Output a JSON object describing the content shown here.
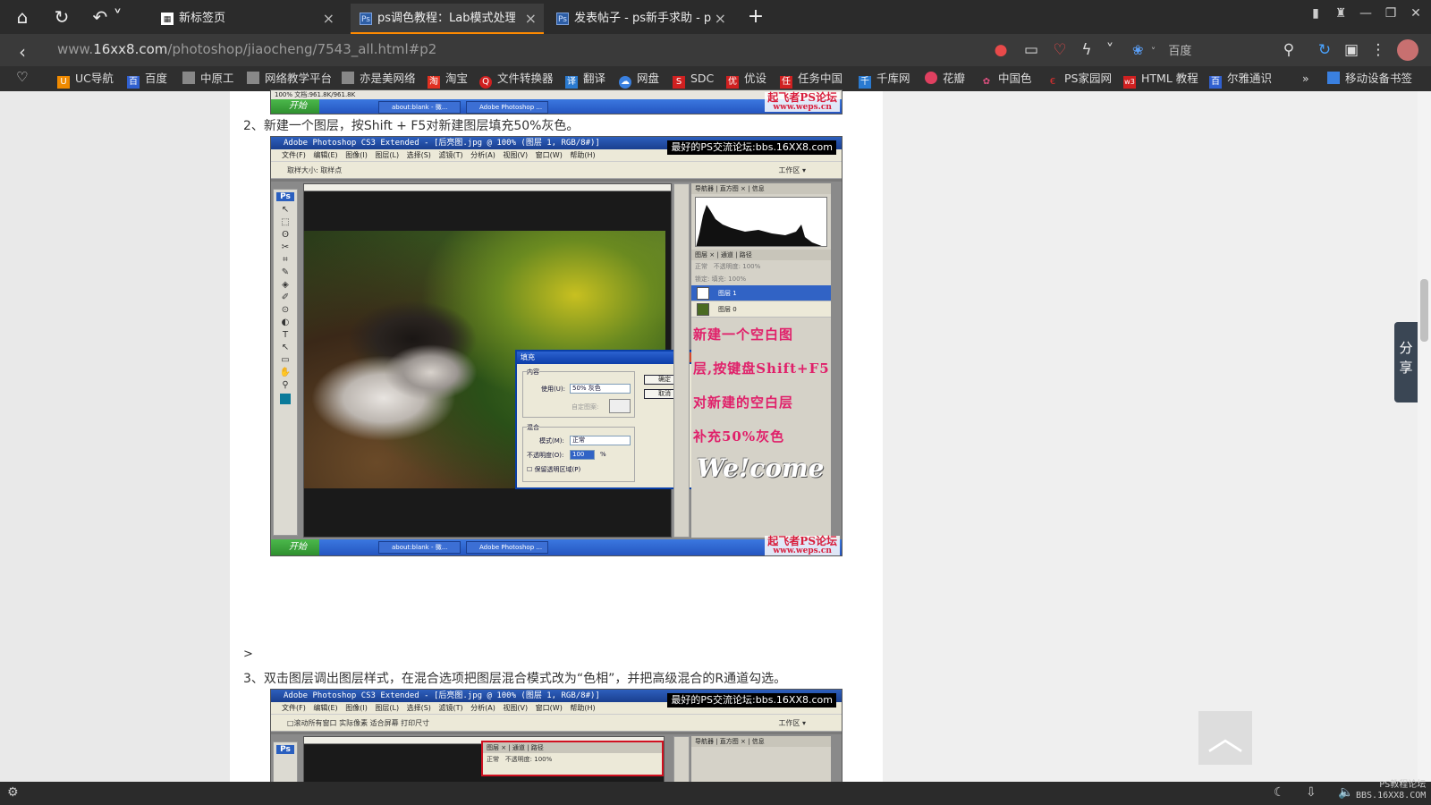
{
  "tabs": [
    {
      "title": "新标签页",
      "icon": "new-tab-icon"
    },
    {
      "title": "ps调色教程：Lab模式处理出",
      "icon": "ps-icon",
      "active": true
    },
    {
      "title": "发表帖子 - ps新手求助 - ps",
      "icon": "ps-icon"
    }
  ],
  "address": {
    "prefix": "www.",
    "domain": "16xx8.com",
    "path": "/photoshop/jiaocheng/7543_all.html#p2"
  },
  "search": {
    "engine": "百度"
  },
  "bookmarks": [
    "UC导航",
    "百度",
    "中原工",
    "网络教学平台",
    "亦是美网络",
    "淘宝",
    "文件转换器",
    "翻译",
    "网盘",
    "SDC",
    "优设",
    "任务中国",
    "千库网",
    "花瓣",
    "中国色",
    "PS家园网",
    "HTML 教程",
    "尔雅通识",
    "移动设备书签"
  ],
  "article": {
    "step2": "2、新建一个图层，按Shift + F5对新建图层填充50%灰色。",
    "gt": ">",
    "step3": "3、双击图层调出图层样式，在混合选项把图层混合模式改为“色相”，并把高级混合的R通道勾选。"
  },
  "screenshot1": {
    "ps_title": "Adobe Photoshop CS3 Extended - [后亮图.jpg @ 100% (图层 1, RGB/8#)]",
    "forum_tag": "最好的PS交流论坛:bbs.16XX8.com",
    "menu": "文件(F) 编辑(E) 图像(I) 图层(L) 选择(S) 滤镜(T) 分析(A) 视图(V) 窗口(W) 帮助(H)",
    "options": "取样大小: 取样点",
    "workspace": "工作区 ▾",
    "dialog": {
      "title": "填充",
      "content_group": "内容",
      "use_label": "使用(U):",
      "use_value": "50% 灰色",
      "custom_label": "自定图案:",
      "blend_group": "混合",
      "mode_label": "模式(M):",
      "mode_value": "正常",
      "opacity_label": "不透明度(O):",
      "opacity_value": "100",
      "percent": "%",
      "preserve": "保留透明区域(P)",
      "ok": "确定",
      "cancel": "取消"
    },
    "panel_tabs1": "导航器 | 直方图 × | 信息",
    "panel_tabs2": "图层 × | 通道 | 路径",
    "blend": "正常",
    "opacity": "不透明度: 100%",
    "fill": "锁定: 填充: 100%",
    "layers": [
      "图层 1",
      "图层 0"
    ],
    "handwriting": [
      "新建一个空白图",
      "层,按键盘Shift+F5",
      "对新建的空白层",
      "补充50%灰色"
    ],
    "welcome": "We!come",
    "status": "100%  文档:961.8K/961.8K",
    "start": "开始",
    "task1": "about:blank - 微...",
    "task2": "Adobe Photoshop ...",
    "watermark": "起飞者PS论坛",
    "watermark_url": "www.weps.cn"
  },
  "screenshot2": {
    "ps_title": "Adobe Photoshop CS3 Extended - [后亮图.jpg @ 100% (图层 1, RGB/8#)]",
    "forum_tag": "最好的PS交流论坛:bbs.16XX8.com",
    "menu": "文件(F) 编辑(E) 图像(I) 图层(L) 选择(S) 滤镜(T) 分析(A) 视图(V) 窗口(W) 帮助(H)",
    "options": "□滚动所有窗口   实际像素   适合屏幕   打印尺寸",
    "workspace": "工作区 ▾",
    "layers_tabs": "图层 × | 通道 | 路径",
    "blend": "正常",
    "opacity": "不透明度: 100%",
    "panel_tabs": "导航器 | 直方图 × | 信息"
  },
  "share_label": "分享",
  "status_watermark": [
    "PS教程论坛",
    "BBS.16XX8.COM"
  ],
  "colors": {
    "accent": "#ff8a00",
    "tabbar": "#2b2b2b",
    "handwriting": "#e0206a"
  }
}
